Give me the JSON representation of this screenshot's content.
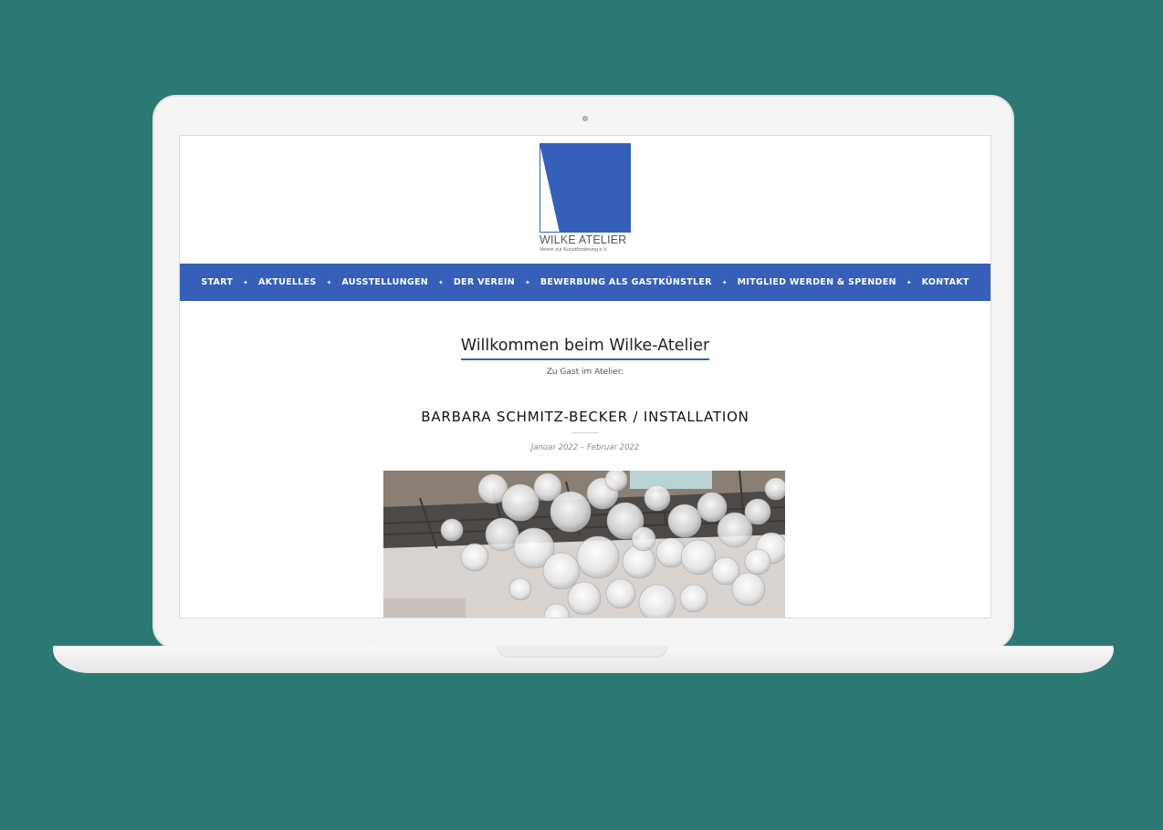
{
  "logo": {
    "title": "WILKE ATELIER",
    "subtitle": "Verein zur Kunstförderung e.V.",
    "color": "#365fba"
  },
  "nav": {
    "items": [
      {
        "label": "START"
      },
      {
        "label": "AKTUELLES"
      },
      {
        "label": "AUSSTELLUNGEN"
      },
      {
        "label": "DER VEREIN"
      },
      {
        "label": "BEWERBUNG ALS GASTKÜNSTLER"
      },
      {
        "label": "MITGLIED WERDEN & SPENDEN"
      },
      {
        "label": "KONTAKT"
      }
    ],
    "separator": "✦",
    "background": "#365fba"
  },
  "welcome": {
    "title": "Willkommen beim Wilke-Atelier",
    "subtitle": "Zu Gast im Atelier:"
  },
  "exhibition": {
    "title": "BARBARA SCHMITZ-BECKER / INSTALLATION",
    "date": "Januar 2022 – Februar 2022"
  },
  "colors": {
    "background": "#2a7a73",
    "accent": "#365fba"
  }
}
